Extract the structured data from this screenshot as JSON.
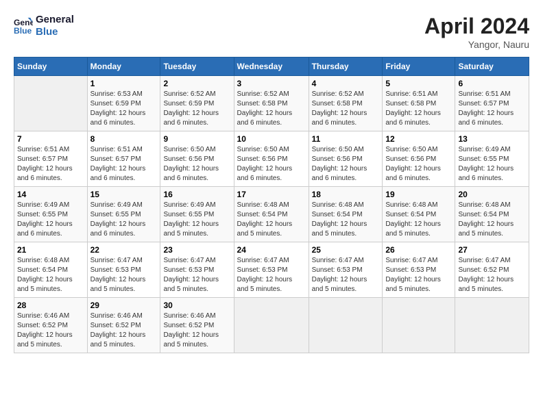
{
  "header": {
    "logo_line1": "General",
    "logo_line2": "Blue",
    "month": "April 2024",
    "location": "Yangor, Nauru"
  },
  "days_of_week": [
    "Sunday",
    "Monday",
    "Tuesday",
    "Wednesday",
    "Thursday",
    "Friday",
    "Saturday"
  ],
  "weeks": [
    [
      {
        "day": "",
        "content": ""
      },
      {
        "day": "1",
        "content": "Sunrise: 6:53 AM\nSunset: 6:59 PM\nDaylight: 12 hours\nand 6 minutes."
      },
      {
        "day": "2",
        "content": "Sunrise: 6:52 AM\nSunset: 6:59 PM\nDaylight: 12 hours\nand 6 minutes."
      },
      {
        "day": "3",
        "content": "Sunrise: 6:52 AM\nSunset: 6:58 PM\nDaylight: 12 hours\nand 6 minutes."
      },
      {
        "day": "4",
        "content": "Sunrise: 6:52 AM\nSunset: 6:58 PM\nDaylight: 12 hours\nand 6 minutes."
      },
      {
        "day": "5",
        "content": "Sunrise: 6:51 AM\nSunset: 6:58 PM\nDaylight: 12 hours\nand 6 minutes."
      },
      {
        "day": "6",
        "content": "Sunrise: 6:51 AM\nSunset: 6:57 PM\nDaylight: 12 hours\nand 6 minutes."
      }
    ],
    [
      {
        "day": "7",
        "content": "Sunrise: 6:51 AM\nSunset: 6:57 PM\nDaylight: 12 hours\nand 6 minutes."
      },
      {
        "day": "8",
        "content": "Sunrise: 6:51 AM\nSunset: 6:57 PM\nDaylight: 12 hours\nand 6 minutes."
      },
      {
        "day": "9",
        "content": "Sunrise: 6:50 AM\nSunset: 6:56 PM\nDaylight: 12 hours\nand 6 minutes."
      },
      {
        "day": "10",
        "content": "Sunrise: 6:50 AM\nSunset: 6:56 PM\nDaylight: 12 hours\nand 6 minutes."
      },
      {
        "day": "11",
        "content": "Sunrise: 6:50 AM\nSunset: 6:56 PM\nDaylight: 12 hours\nand 6 minutes."
      },
      {
        "day": "12",
        "content": "Sunrise: 6:50 AM\nSunset: 6:56 PM\nDaylight: 12 hours\nand 6 minutes."
      },
      {
        "day": "13",
        "content": "Sunrise: 6:49 AM\nSunset: 6:55 PM\nDaylight: 12 hours\nand 6 minutes."
      }
    ],
    [
      {
        "day": "14",
        "content": "Sunrise: 6:49 AM\nSunset: 6:55 PM\nDaylight: 12 hours\nand 6 minutes."
      },
      {
        "day": "15",
        "content": "Sunrise: 6:49 AM\nSunset: 6:55 PM\nDaylight: 12 hours\nand 6 minutes."
      },
      {
        "day": "16",
        "content": "Sunrise: 6:49 AM\nSunset: 6:55 PM\nDaylight: 12 hours\nand 5 minutes."
      },
      {
        "day": "17",
        "content": "Sunrise: 6:48 AM\nSunset: 6:54 PM\nDaylight: 12 hours\nand 5 minutes."
      },
      {
        "day": "18",
        "content": "Sunrise: 6:48 AM\nSunset: 6:54 PM\nDaylight: 12 hours\nand 5 minutes."
      },
      {
        "day": "19",
        "content": "Sunrise: 6:48 AM\nSunset: 6:54 PM\nDaylight: 12 hours\nand 5 minutes."
      },
      {
        "day": "20",
        "content": "Sunrise: 6:48 AM\nSunset: 6:54 PM\nDaylight: 12 hours\nand 5 minutes."
      }
    ],
    [
      {
        "day": "21",
        "content": "Sunrise: 6:48 AM\nSunset: 6:54 PM\nDaylight: 12 hours\nand 5 minutes."
      },
      {
        "day": "22",
        "content": "Sunrise: 6:47 AM\nSunset: 6:53 PM\nDaylight: 12 hours\nand 5 minutes."
      },
      {
        "day": "23",
        "content": "Sunrise: 6:47 AM\nSunset: 6:53 PM\nDaylight: 12 hours\nand 5 minutes."
      },
      {
        "day": "24",
        "content": "Sunrise: 6:47 AM\nSunset: 6:53 PM\nDaylight: 12 hours\nand 5 minutes."
      },
      {
        "day": "25",
        "content": "Sunrise: 6:47 AM\nSunset: 6:53 PM\nDaylight: 12 hours\nand 5 minutes."
      },
      {
        "day": "26",
        "content": "Sunrise: 6:47 AM\nSunset: 6:53 PM\nDaylight: 12 hours\nand 5 minutes."
      },
      {
        "day": "27",
        "content": "Sunrise: 6:47 AM\nSunset: 6:52 PM\nDaylight: 12 hours\nand 5 minutes."
      }
    ],
    [
      {
        "day": "28",
        "content": "Sunrise: 6:46 AM\nSunset: 6:52 PM\nDaylight: 12 hours\nand 5 minutes."
      },
      {
        "day": "29",
        "content": "Sunrise: 6:46 AM\nSunset: 6:52 PM\nDaylight: 12 hours\nand 5 minutes."
      },
      {
        "day": "30",
        "content": "Sunrise: 6:46 AM\nSunset: 6:52 PM\nDaylight: 12 hours\nand 5 minutes."
      },
      {
        "day": "",
        "content": ""
      },
      {
        "day": "",
        "content": ""
      },
      {
        "day": "",
        "content": ""
      },
      {
        "day": "",
        "content": ""
      }
    ]
  ]
}
